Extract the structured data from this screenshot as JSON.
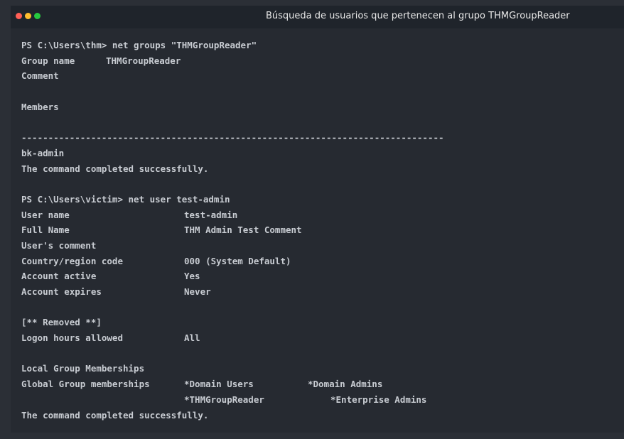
{
  "window": {
    "title": "Búsqueda de usuarios que pertenecen al grupo THMGroupReader"
  },
  "terminal": {
    "lines": [
      [
        "PS C:\\Users\\thm> net groups \"THMGroupReader\""
      ],
      [
        "Group name",
        "THMGroupReader"
      ],
      [
        "Comment"
      ],
      [
        ""
      ],
      [
        "Members"
      ],
      [
        ""
      ],
      [
        "-------------------------------------------------------------------------------"
      ],
      [
        "bk-admin"
      ],
      [
        "The command completed successfully."
      ],
      [
        ""
      ],
      [
        "PS C:\\Users\\victim> net user test-admin"
      ],
      [
        "User name",
        "test-admin"
      ],
      [
        "Full Name",
        "THM Admin Test Comment"
      ],
      [
        "User's comment"
      ],
      [
        "Country/region code",
        "000 (System Default)"
      ],
      [
        "Account active",
        "Yes"
      ],
      [
        "Account expires",
        "Never"
      ],
      [
        ""
      ],
      [
        "[** Removed **]"
      ],
      [
        "Logon hours allowed",
        "All"
      ],
      [
        ""
      ],
      [
        "Local Group Memberships"
      ],
      [
        "Global Group memberships",
        "*Domain Users",
        "*Domain Admins"
      ],
      [
        "",
        "*THMGroupReader",
        "*Enterprise Admins"
      ],
      [
        "The command completed successfully."
      ]
    ]
  }
}
